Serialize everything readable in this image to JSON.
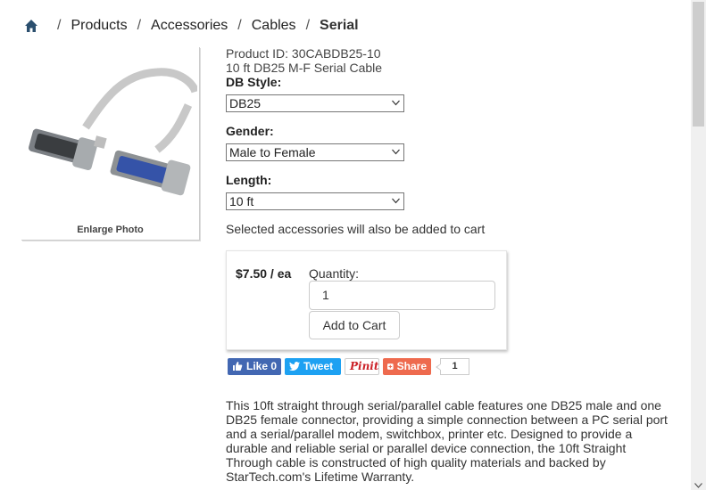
{
  "breadcrumb": {
    "items": [
      "Products",
      "Accessories",
      "Cables"
    ],
    "current": "Serial",
    "separator": "/"
  },
  "photo": {
    "enlarge_label": "Enlarge Photo"
  },
  "product": {
    "id_line": "Product ID: 30CABDB25-10",
    "title": "10 ft DB25 M-F Serial Cable"
  },
  "options": {
    "db_style": {
      "label": "DB Style:",
      "value": "DB25"
    },
    "gender": {
      "label": "Gender:",
      "value": "Male to Female"
    },
    "length": {
      "label": "Length:",
      "value": "10 ft"
    }
  },
  "accessories_note": "Selected accessories will also be added to cart",
  "cart": {
    "price": "$7.50 / ea",
    "quantity_label": "Quantity:",
    "quantity_value": "1",
    "add_button": "Add to Cart"
  },
  "share": {
    "like": "Like 0",
    "tweet": "Tweet",
    "pinit": "Pinit",
    "share": "Share",
    "count": "1"
  },
  "description": "This 10ft straight through serial/parallel cable features one DB25 male and one DB25 female connector, providing a simple connection between a PC serial port and a serial/parallel modem, switchbox, printer etc. Designed to provide a durable and reliable serial or parallel device connection, the 10ft Straight Through cable is constructed of high quality materials and backed by StarTech.com's Lifetime Warranty.",
  "colors": {
    "facebook": "#4267b2",
    "twitter": "#1da1f2",
    "pinterest": "#cb2027",
    "share": "#ee6a4e"
  },
  "icons": [
    "home-icon",
    "chevron-down-icon",
    "facebook-thumb-icon",
    "twitter-bird-icon",
    "plus-square-icon"
  ]
}
